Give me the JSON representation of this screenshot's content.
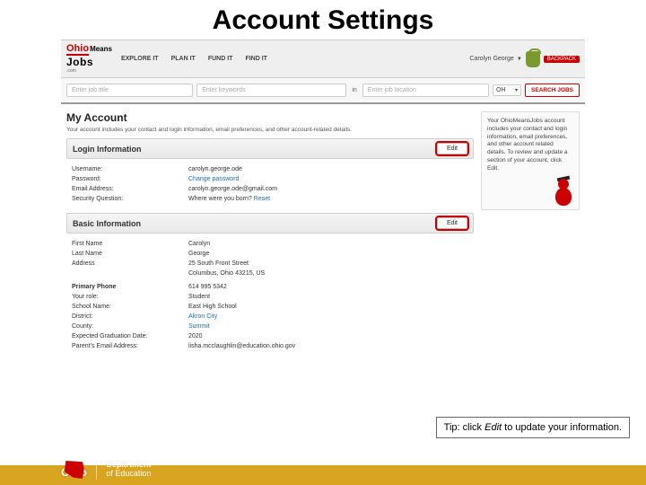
{
  "slide": {
    "title": "Account Settings"
  },
  "logo": {
    "ohio": "Ohio",
    "means": "Means",
    "jobs": "Jobs",
    "com": ".com"
  },
  "nav": {
    "explore": "EXPLORE IT",
    "plan": "PLAN IT",
    "fund": "FUND IT",
    "find": "FIND IT"
  },
  "user": {
    "name": "Carolyn George",
    "caret": "▼",
    "backpack": "BACKPACK"
  },
  "search": {
    "title_ph": "Enter job title",
    "kw_ph": "Enter keywords",
    "in": "in",
    "loc_ph": "Enter job location",
    "state": "OH",
    "button": "SEARCH JOBS"
  },
  "account": {
    "heading": "My Account",
    "intro": "Your account includes your contact and login information, email preferences, and other account-related details."
  },
  "login": {
    "title": "Login Information",
    "edit": "Edit",
    "rows": {
      "username_l": "Username:",
      "username_v": "carolyn.george.ode",
      "password_l": "Password:",
      "password_v": "Change password",
      "email_l": "Email Address:",
      "email_v": "carolyn.george.ode@gmail.com",
      "secq_l": "Security Question:",
      "secq_v": "Where were you born? ",
      "secq_reset": "Reset"
    }
  },
  "basic": {
    "title": "Basic Information",
    "edit": "Edit",
    "rows": {
      "first_l": "First Name",
      "first_v": "Carolyn",
      "last_l": "Last Name",
      "last_v": "George",
      "addr_l": "Address",
      "addr_v1": "25 South Front Street",
      "addr_v2": "Columbus, Ohio 43215, US",
      "phone_l": "Primary Phone",
      "phone_v": "614 995 5342",
      "role_l": "Your role:",
      "role_v": "Student",
      "school_l": "School Name:",
      "school_v": "East High School",
      "district_l": "District:",
      "district_v": "Akron City",
      "county_l": "County:",
      "county_v": "Summit",
      "grad_l": "Expected Graduation Date:",
      "grad_v": "2020",
      "pemail_l": "Parent's Email Address:",
      "pemail_v": "lisha.mcclaughlin@education.ohio.gov"
    }
  },
  "sidebar": {
    "text": "Your OhioMeansJobs account includes your contact and login information, email preferences, and other account related details. To review and update a section of your account, click Edit."
  },
  "tip": {
    "pre": "Tip: click ",
    "em": "Edit",
    "post": " to update your information."
  },
  "footer": {
    "ohio": "Ohio",
    "dept1": "Department",
    "dept2": "of Education"
  }
}
